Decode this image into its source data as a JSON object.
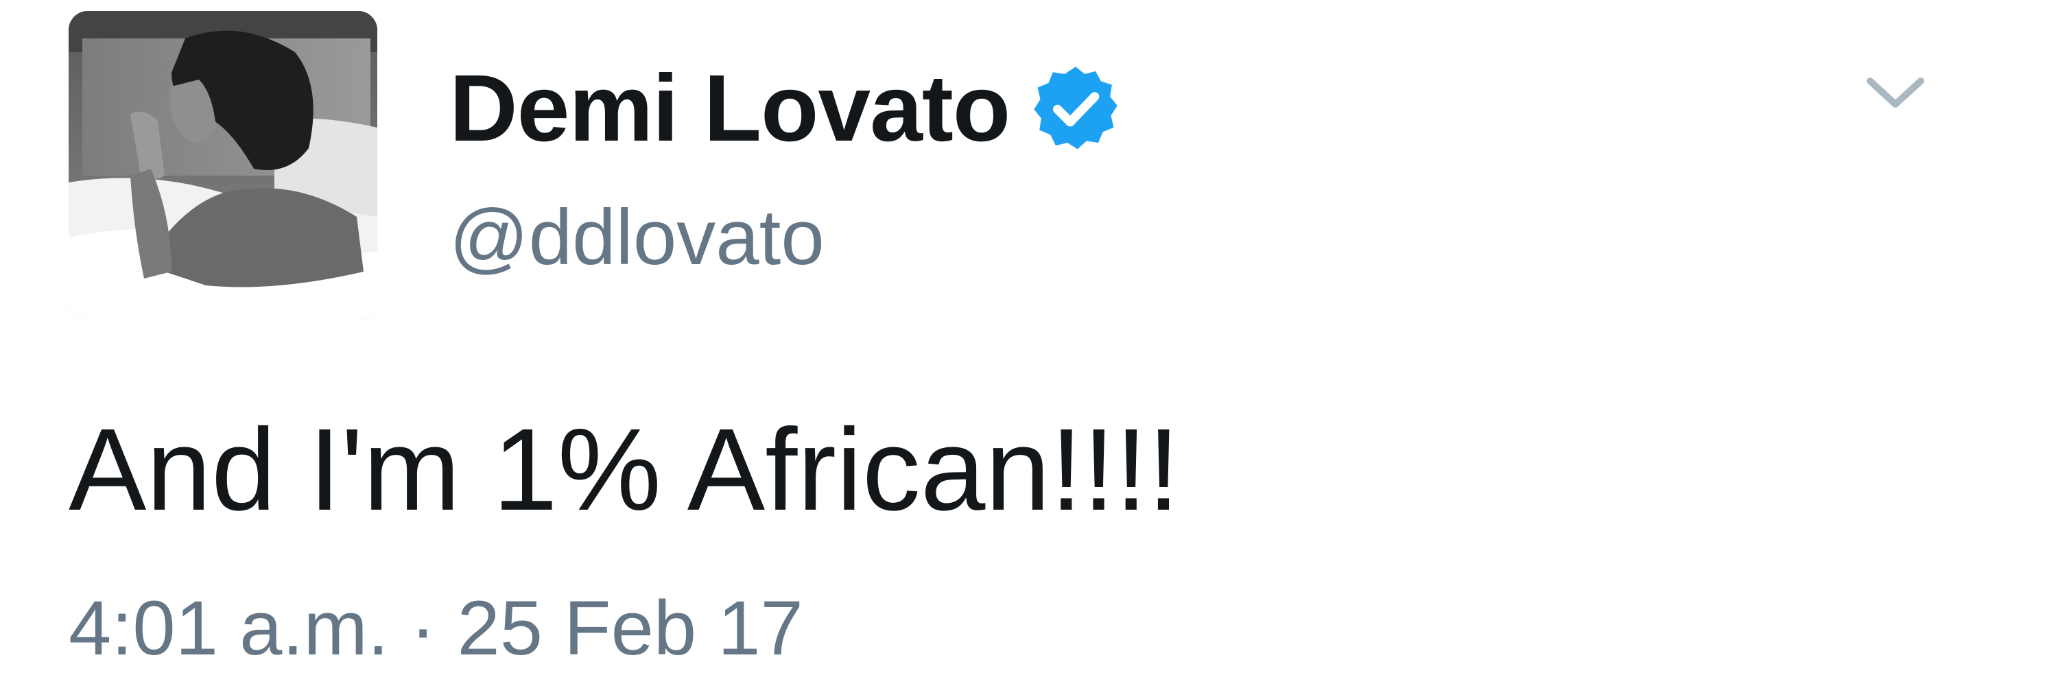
{
  "user": {
    "display_name": "Demi Lovato",
    "handle": "@ddlovato",
    "verified": true,
    "avatar_icon": "profile-photo"
  },
  "tweet": {
    "text": "And I'm 1% African!!!!",
    "timestamp": "4:01 a.m. · 25 Feb 17"
  },
  "icons": {
    "verified": "verified-badge-icon",
    "menu": "chevron-down-icon"
  },
  "colors": {
    "verified_blue": "#1da1f2",
    "secondary_text": "#657786",
    "primary_text": "#14171a",
    "caret": "#aab8c2"
  }
}
